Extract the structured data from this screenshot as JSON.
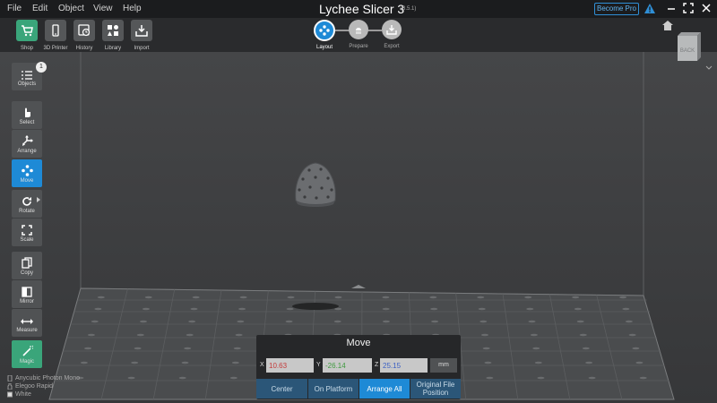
{
  "menu": {
    "file": "File",
    "edit": "Edit",
    "object": "Object",
    "view": "View",
    "help": "Help"
  },
  "app": {
    "title": "Lychee Slicer 3",
    "version": "(3.5.1)",
    "become_pro": "Become Pro"
  },
  "toolbar": {
    "shop": "Shop",
    "printer": "3D Printer",
    "history": "History",
    "library": "Library",
    "import": "Import"
  },
  "stages": {
    "layout": "Layout",
    "prepare": "Prepare",
    "export": "Export"
  },
  "sidebar": {
    "objects": "Objects",
    "objects_count": "1",
    "select": "Select",
    "arrange": "Arrange",
    "move": "Move",
    "rotate": "Rotate",
    "scale": "Scale",
    "copy": "Copy",
    "mirror": "Mirror",
    "measure": "Measure",
    "magic": "Magic"
  },
  "view_cube": {
    "face": "BACK"
  },
  "printer_info": {
    "printer": "Anycubic Photon Mono",
    "resin": "Elegoo Rapid",
    "color": "White"
  },
  "move_panel": {
    "title": "Move",
    "x_label": "X",
    "x_value": "10.63",
    "y_label": "Y",
    "y_value": "-26.14",
    "z_label": "Z",
    "z_value": "25.15",
    "unit": "mm",
    "center": "Center",
    "on_platform": "On Platform",
    "arrange_all": "Arrange All",
    "original_line1": "Original File",
    "original_line2": "Position"
  },
  "colors": {
    "accent": "#1e8ad6",
    "x_axis": "#c43a3a",
    "y_axis": "#3f9a3f",
    "z_axis": "#3a5fc4",
    "magic": "#3aa57a"
  }
}
